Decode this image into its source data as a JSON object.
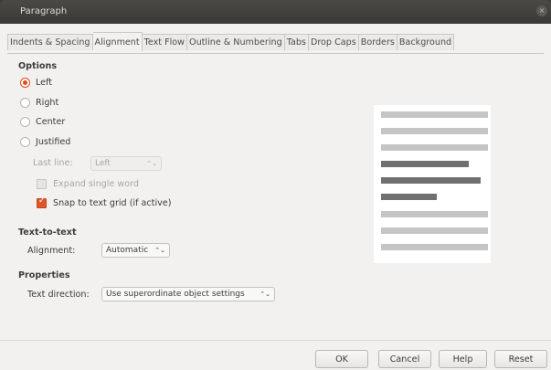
{
  "window": {
    "title": "Paragraph",
    "close_glyph": "×"
  },
  "tabs": [
    {
      "label": "Indents & Spacing",
      "active": false
    },
    {
      "label": "Alignment",
      "active": true
    },
    {
      "label": "Text Flow",
      "active": false
    },
    {
      "label": "Outline & Numbering",
      "active": false
    },
    {
      "label": "Tabs",
      "active": false
    },
    {
      "label": "Drop Caps",
      "active": false
    },
    {
      "label": "Borders",
      "active": false
    },
    {
      "label": "Background",
      "active": false
    }
  ],
  "options": {
    "heading": "Options",
    "radios": [
      {
        "label": "Left",
        "checked": true
      },
      {
        "label": "Right",
        "checked": false
      },
      {
        "label": "Center",
        "checked": false
      },
      {
        "label": "Justified",
        "checked": false
      }
    ],
    "last_line_label": "Last line:",
    "last_line_value": "Left",
    "expand_single_word": "Expand single word",
    "snap_to_grid": "Snap to text grid (if active)"
  },
  "text_to_text": {
    "heading": "Text-to-text",
    "alignment_label": "Alignment:",
    "alignment_value": "Automatic"
  },
  "properties": {
    "heading": "Properties",
    "text_direction_label": "Text direction:",
    "text_direction_value": "Use superordinate object settings"
  },
  "buttons": {
    "ok": "OK",
    "cancel": "Cancel",
    "help": "Help",
    "reset": "Reset"
  },
  "colors": {
    "accent": "#df4a16",
    "titlebar": "#3c3b37",
    "dialog_bg": "#f2f1f0"
  },
  "icons": {
    "spin": "⌃⌄"
  }
}
